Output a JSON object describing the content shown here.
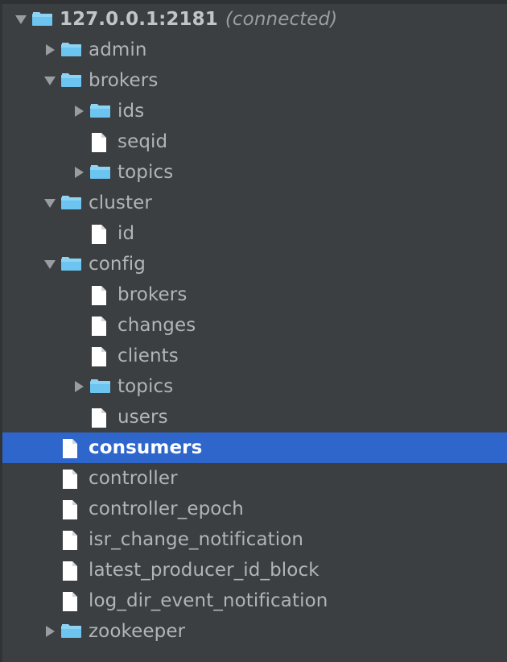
{
  "panel": {
    "name": "zookeeper-node-tree",
    "background": "#3c3f41",
    "selection_color": "#2f66cc",
    "text_color": "#b2b5b8",
    "folder_color": "#6cc4f0",
    "file_color": "#ffffff",
    "arrow_color": "#9a9da0"
  },
  "tree": {
    "items": [
      {
        "label": "127.0.0.1:2181",
        "suffix": "(connected)",
        "depth": 0,
        "icon": "folder-icon",
        "twisty": "expanded",
        "selected": false,
        "root": true
      },
      {
        "label": "admin",
        "suffix": "",
        "depth": 1,
        "icon": "folder-icon",
        "twisty": "collapsed",
        "selected": false,
        "root": false
      },
      {
        "label": "brokers",
        "suffix": "",
        "depth": 1,
        "icon": "folder-icon",
        "twisty": "expanded",
        "selected": false,
        "root": false
      },
      {
        "label": "ids",
        "suffix": "",
        "depth": 2,
        "icon": "folder-icon",
        "twisty": "collapsed",
        "selected": false,
        "root": false
      },
      {
        "label": "seqid",
        "suffix": "",
        "depth": 2,
        "icon": "file-icon",
        "twisty": "none",
        "selected": false,
        "root": false
      },
      {
        "label": "topics",
        "suffix": "",
        "depth": 2,
        "icon": "folder-icon",
        "twisty": "collapsed",
        "selected": false,
        "root": false
      },
      {
        "label": "cluster",
        "suffix": "",
        "depth": 1,
        "icon": "folder-icon",
        "twisty": "expanded",
        "selected": false,
        "root": false
      },
      {
        "label": "id",
        "suffix": "",
        "depth": 2,
        "icon": "file-icon",
        "twisty": "none",
        "selected": false,
        "root": false
      },
      {
        "label": "config",
        "suffix": "",
        "depth": 1,
        "icon": "folder-icon",
        "twisty": "expanded",
        "selected": false,
        "root": false
      },
      {
        "label": "brokers",
        "suffix": "",
        "depth": 2,
        "icon": "file-icon",
        "twisty": "none",
        "selected": false,
        "root": false
      },
      {
        "label": "changes",
        "suffix": "",
        "depth": 2,
        "icon": "file-icon",
        "twisty": "none",
        "selected": false,
        "root": false
      },
      {
        "label": "clients",
        "suffix": "",
        "depth": 2,
        "icon": "file-icon",
        "twisty": "none",
        "selected": false,
        "root": false
      },
      {
        "label": "topics",
        "suffix": "",
        "depth": 2,
        "icon": "folder-icon",
        "twisty": "collapsed",
        "selected": false,
        "root": false
      },
      {
        "label": "users",
        "suffix": "",
        "depth": 2,
        "icon": "file-icon",
        "twisty": "none",
        "selected": false,
        "root": false
      },
      {
        "label": "consumers",
        "suffix": "",
        "depth": 1,
        "icon": "file-icon",
        "twisty": "none",
        "selected": true,
        "root": false
      },
      {
        "label": "controller",
        "suffix": "",
        "depth": 1,
        "icon": "file-icon",
        "twisty": "none",
        "selected": false,
        "root": false
      },
      {
        "label": "controller_epoch",
        "suffix": "",
        "depth": 1,
        "icon": "file-icon",
        "twisty": "none",
        "selected": false,
        "root": false
      },
      {
        "label": "isr_change_notification",
        "suffix": "",
        "depth": 1,
        "icon": "file-icon",
        "twisty": "none",
        "selected": false,
        "root": false
      },
      {
        "label": "latest_producer_id_block",
        "suffix": "",
        "depth": 1,
        "icon": "file-icon",
        "twisty": "none",
        "selected": false,
        "root": false
      },
      {
        "label": "log_dir_event_notification",
        "suffix": "",
        "depth": 1,
        "icon": "file-icon",
        "twisty": "none",
        "selected": false,
        "root": false
      },
      {
        "label": "zookeeper",
        "suffix": "",
        "depth": 1,
        "icon": "folder-icon",
        "twisty": "collapsed",
        "selected": false,
        "root": false
      }
    ]
  }
}
